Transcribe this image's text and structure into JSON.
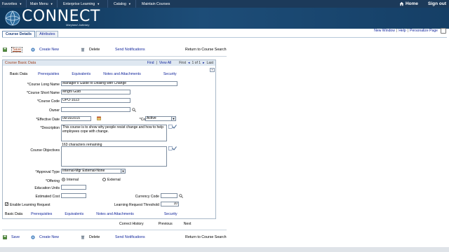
{
  "topnav": {
    "items": [
      "Favorites",
      "Main Menu",
      "Enterprise Learning",
      "Catalog",
      "Maintain Courses"
    ],
    "home_label": "Home",
    "signout_label": "Sign out"
  },
  "banner": {
    "logo_text": "CONNECT",
    "logo_sub": "Maryland Judiciary"
  },
  "toplinks": {
    "new_window": "New Window",
    "help": "Help",
    "personalize": "Personalize Page",
    "sep": "|"
  },
  "tabs": [
    "Course Details",
    "Attributes"
  ],
  "toolbar": {
    "save": "Save",
    "create_new": "Create New",
    "delete": "Delete",
    "send_notifications": "Send Notifications",
    "return": "Return to Course Search"
  },
  "group": {
    "title": "Course Basic Data",
    "find": "Find",
    "view_all": "View All",
    "first": "First",
    "range": "1 of 1",
    "last": "Last"
  },
  "subnav": [
    "Basic Data",
    "Prerequisites",
    "Equivalents",
    "Notes and Attachments",
    "Security"
  ],
  "form": {
    "long_name_label": "*Course Long Name",
    "long_name_value": "Manager's Guide to Dealing with Change",
    "short_name_label": "*Course Short Name",
    "short_name_value": "Mngrs Guid",
    "code_label": "*Course Code",
    "code_value": "OPO-1023",
    "owner_label": "Owner",
    "owner_value": "",
    "effective_date_label": "*Effective Date",
    "effective_date_value": "09/16/2015",
    "status_label": "*Course Status",
    "status_value": "Active",
    "description_label": "*Description",
    "description_value": "This course is to show why people resist change and how to help employees cope with change.",
    "chars_remaining": "163 characters remaining",
    "objectives_label": "Course Objectives",
    "objectives_value": "",
    "approval_label": "*Approval Type",
    "approval_value": "Internal-Mgr External-None",
    "offering_label": "*Offering",
    "offering_internal": "Internal",
    "offering_external": "External",
    "education_units_label": "Education Units",
    "estimated_cost_label": "Estimated Cost",
    "currency_label": "Currency Code",
    "enable_learning_label": "Enable Learning Request",
    "threshold_label": "Learning Request Threshold",
    "threshold_value": "10"
  },
  "footer": {
    "correct_history": "Correct History",
    "previous": "Previous",
    "next": "Next"
  },
  "colors": {
    "nav_bg": "#1c3a5a",
    "link": "#13279c",
    "group_title": "#a0401d"
  }
}
